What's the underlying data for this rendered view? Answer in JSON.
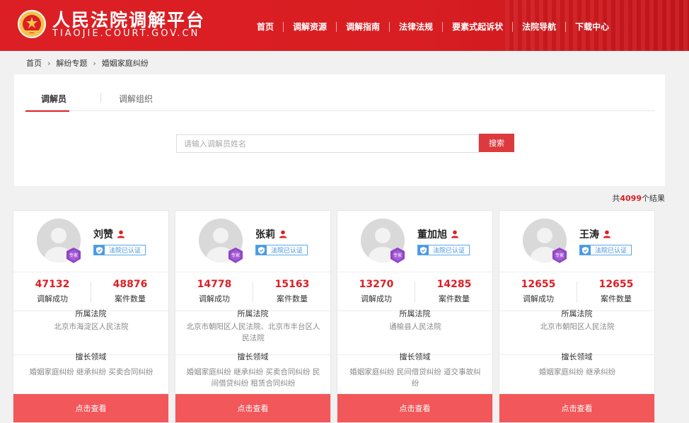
{
  "header": {
    "title": "人民法院调解平台",
    "subtitle": "TIAOJIE.COURT.GOV.CN",
    "nav": [
      "首页",
      "调解资源",
      "调解指南",
      "法律法规",
      "要素式起诉状",
      "法院导航",
      "下载中心"
    ]
  },
  "breadcrumb": [
    "首页",
    "解纷专题",
    "婚姻家庭纠纷"
  ],
  "tabs": [
    "调解员",
    "调解组织"
  ],
  "search": {
    "placeholder": "请输入调解员姓名",
    "button": "搜索"
  },
  "total": {
    "prefix": "共",
    "count": "4099",
    "suffix": "个结果"
  },
  "card_labels": {
    "badge": "专家",
    "cert": "法院已认证",
    "success": "调解成功",
    "cases": "案件数量",
    "court_title": "所属法院",
    "field_title": "擅长领域",
    "view": "点击查看"
  },
  "mediators": [
    {
      "name": "刘赞",
      "success": "47132",
      "cases": "48876",
      "court": "北京市海淀区人民法院",
      "field": "婚姻家庭纠纷 继承纠纷 买卖合同纠纷"
    },
    {
      "name": "张莉",
      "success": "14778",
      "cases": "15163",
      "court": "北京市朝阳区人民法院、北京市丰台区人民法院",
      "field": "婚姻家庭纠纷 继承纠纷 买卖合同纠纷 民间借贷纠纷 租赁合同纠纷"
    },
    {
      "name": "董加旭",
      "success": "13270",
      "cases": "14285",
      "court": "通榆县人民法院",
      "field": "婚姻家庭纠纷 民间借贷纠纷 道交事故纠纷"
    },
    {
      "name": "王涛",
      "success": "12655",
      "cases": "12655",
      "court": "北京市朝阳区人民法院",
      "field": "婚姻家庭纠纷 继承纠纷"
    }
  ],
  "colors": {
    "brand": "#dc1f24",
    "button": "#f2575a",
    "cert": "#3b8fe0",
    "badge": "#8e44c4"
  }
}
